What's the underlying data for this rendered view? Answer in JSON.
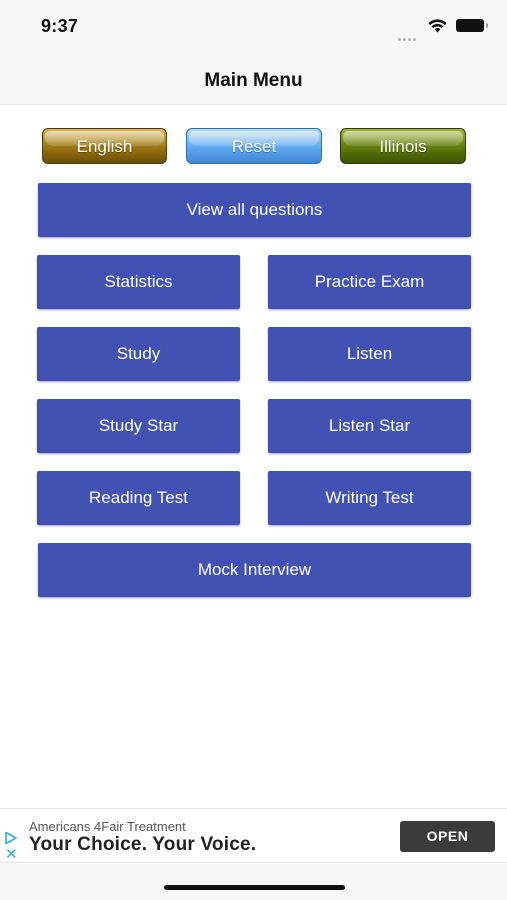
{
  "status_bar": {
    "time": "9:37",
    "icons": [
      "signal-dots-icon",
      "wifi-icon",
      "battery-icon"
    ]
  },
  "nav": {
    "title": "Main Menu"
  },
  "top_buttons": {
    "english": "English",
    "reset": "Reset",
    "illinois": "Illinois"
  },
  "menu": {
    "view_all": "View all questions",
    "statistics": "Statistics",
    "practice_exam": "Practice Exam",
    "study": "Study",
    "listen": "Listen",
    "study_star": "Study Star",
    "listen_star": "Listen Star",
    "reading_test": "Reading Test",
    "writing_test": "Writing Test",
    "mock_interview": "Mock Interview"
  },
  "ad": {
    "sponsor": "Americans 4Fair Treatment",
    "headline": "Your Choice. Your Voice.",
    "cta": "OPEN",
    "choices_icon": "ad-choices-icon",
    "close_icon": "close-icon"
  },
  "colors": {
    "menu_button": "#4152b3",
    "english_button": "#9a7412",
    "reset_button": "#5ea8ef",
    "illinois_button": "#5f7a0a"
  }
}
